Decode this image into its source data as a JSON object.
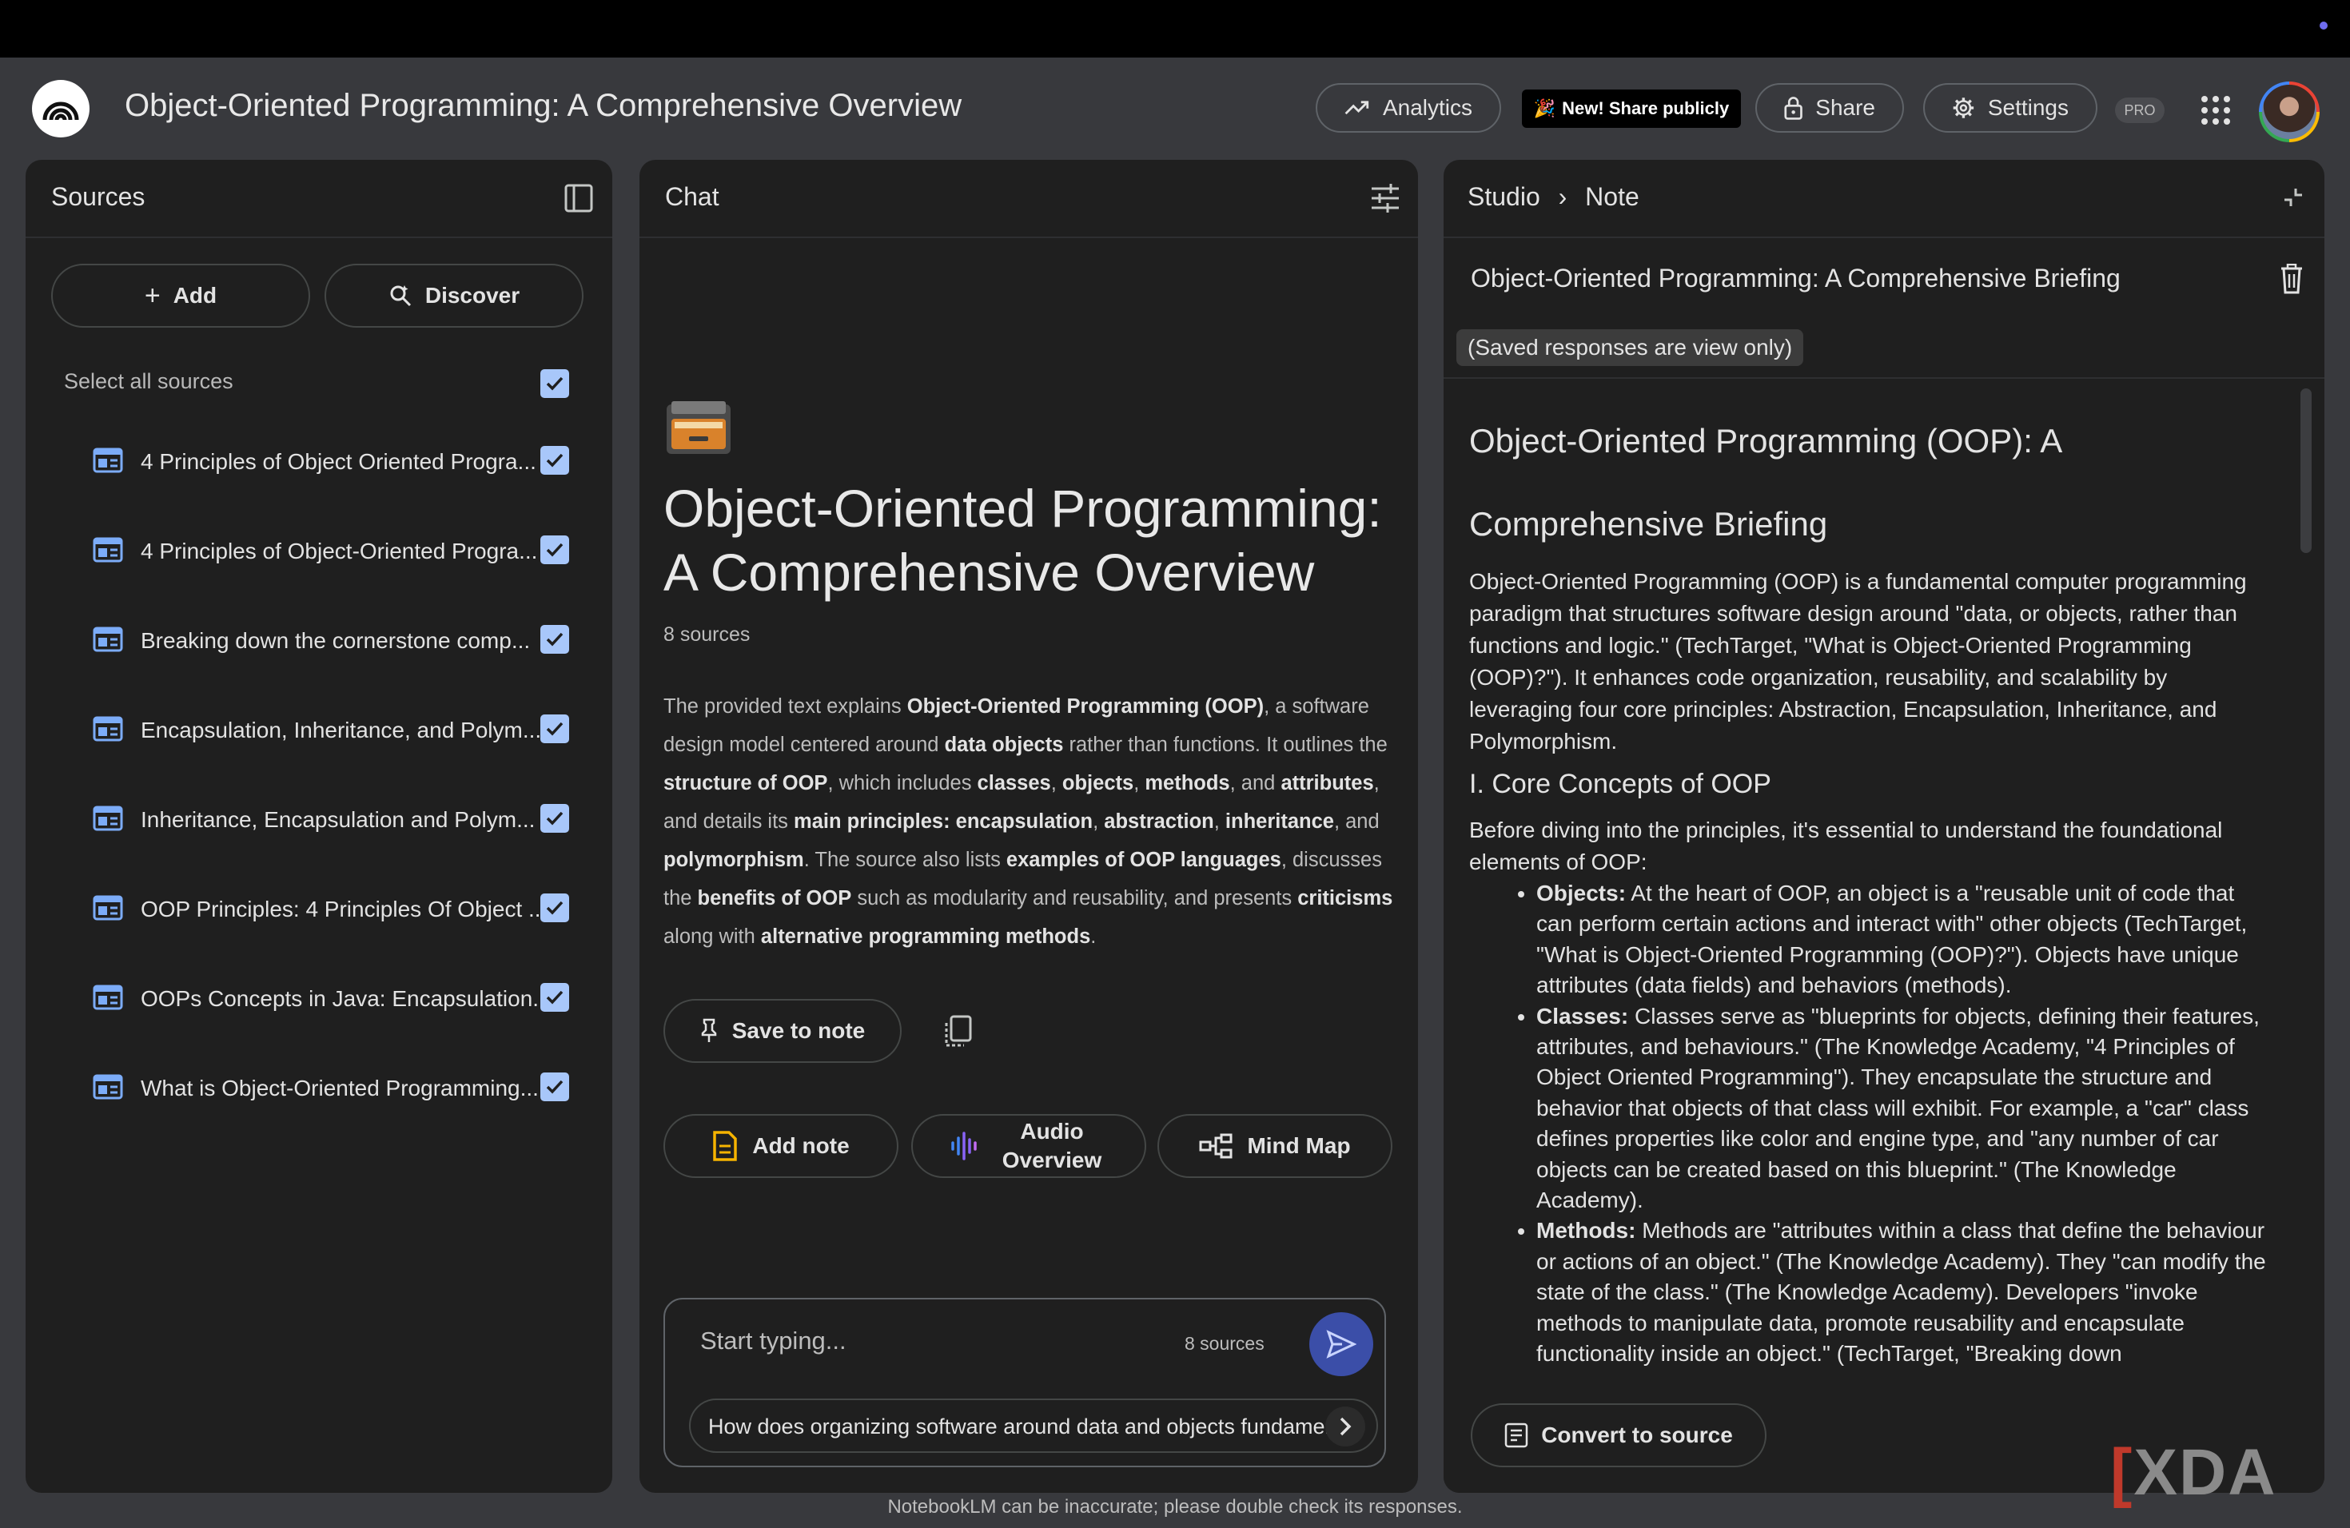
{
  "header": {
    "app_title": "Object-Oriented Programming: A Comprehensive Overview",
    "analytics_label": "Analytics",
    "new_share_label": "New! Share publicly",
    "share_label": "Share",
    "settings_label": "Settings",
    "pro_badge": "PRO"
  },
  "sources_panel": {
    "title": "Sources",
    "add_label": "Add",
    "discover_label": "Discover",
    "select_all_label": "Select all sources",
    "items": [
      {
        "label": "4 Principles of Object Oriented Progra...",
        "checked": true
      },
      {
        "label": "4 Principles of Object-Oriented Progra...",
        "checked": true
      },
      {
        "label": "Breaking down the cornerstone comp...",
        "checked": true
      },
      {
        "label": "Encapsulation, Inheritance, and Polym...",
        "checked": true
      },
      {
        "label": "Inheritance, Encapsulation and Polym...",
        "checked": true
      },
      {
        "label": "OOP Principles: 4 Principles Of Object ...",
        "checked": true
      },
      {
        "label": "OOPs Concepts in Java: Encapsulation...",
        "checked": true
      },
      {
        "label": "What is Object-Oriented Programming...",
        "checked": true
      }
    ]
  },
  "chat_panel": {
    "title": "Chat",
    "notebook_title": "Object-Oriented Programming: A Comprehensive Overview",
    "source_count": "8 sources",
    "summary": {
      "t1": "The provided text explains ",
      "b1": "Object-Oriented Programming (OOP)",
      "t2": ", a software design model centered around ",
      "b2": "data objects",
      "t3": " rather than functions. It outlines the ",
      "b3": "structure of OOP",
      "t4": ", which includes ",
      "b4": "classes",
      "t5": ", ",
      "b5": "objects",
      "t6": ", ",
      "b6": "methods",
      "t7": ", and ",
      "b7": "attributes",
      "t8": ", and details its ",
      "b8": "main principles: encapsulation",
      "t9": ", ",
      "b9": "abstraction",
      "t10": ", ",
      "b10": "inheritance",
      "t11": ", and ",
      "b11": "polymorphism",
      "t12": ". The source also lists ",
      "b12": "examples of OOP languages",
      "t13": ", discusses the ",
      "b13": "benefits of OOP",
      "t14": " such as modularity and reusability, and presents ",
      "b14": "criticisms",
      "t15": " along with ",
      "b15": "alternative programming methods",
      "t16": "."
    },
    "save_to_note_label": "Save to note",
    "add_note_label": "Add note",
    "audio_overview_label": "Audio Overview",
    "mind_map_label": "Mind Map",
    "input_placeholder": "Start typing...",
    "input_source_count": "8 sources",
    "suggestion": "How does organizing software around data and objects fundamentally change software design?"
  },
  "studio_panel": {
    "breadcrumb_studio": "Studio",
    "breadcrumb_note": "Note",
    "note_title": "Object-Oriented Programming: A Comprehensive Briefing",
    "view_only_label": "(Saved responses are view only)",
    "doc_heading": "Object-Oriented Programming (OOP): A Comprehensive Briefing",
    "intro": "Object-Oriented Programming (OOP) is a fundamental computer programming paradigm that structures software design around \"data, or objects, rather than functions and logic.\" (TechTarget, \"What is Object-Oriented Programming (OOP)?\"). It enhances code organization, reusability, and scalability by leveraging four core principles: Abstraction, Encapsulation, Inheritance, and Polymorphism.",
    "section_heading": "I. Core Concepts of OOP",
    "section_intro": "Before diving into the principles, it's essential to understand the foundational elements of OOP:",
    "bullets": [
      {
        "term": "Objects:",
        "text": " At the heart of OOP, an object is a \"reusable unit of code that can perform certain actions and interact with\" other objects (TechTarget, \"What is Object-Oriented Programming (OOP)?\"). Objects have unique attributes (data fields) and behaviors (methods)."
      },
      {
        "term": "Classes:",
        "text": " Classes serve as \"blueprints for objects, defining their features, attributes, and behaviours.\" (The Knowledge Academy, \"4 Principles of Object Oriented Programming\"). They encapsulate the structure and behavior that objects of that class will exhibit. For example, a \"car\" class defines properties like color and engine type, and \"any number of car objects can be created based on this blueprint.\" (The Knowledge Academy)."
      },
      {
        "term": "Methods:",
        "text": " Methods are \"attributes within a class that define the behaviour or actions of an object.\" (The Knowledge Academy). They \"can modify the state of the class.\" (The Knowledge Academy). Developers \"invoke methods to manipulate data, promote reusability and encapsulate functionality inside an object.\" (TechTarget, \"Breaking down"
      }
    ],
    "convert_label": "Convert to source"
  },
  "footer": {
    "disclaimer": "NotebookLM can be inaccurate; please double check its responses.",
    "watermark": "XDA"
  }
}
